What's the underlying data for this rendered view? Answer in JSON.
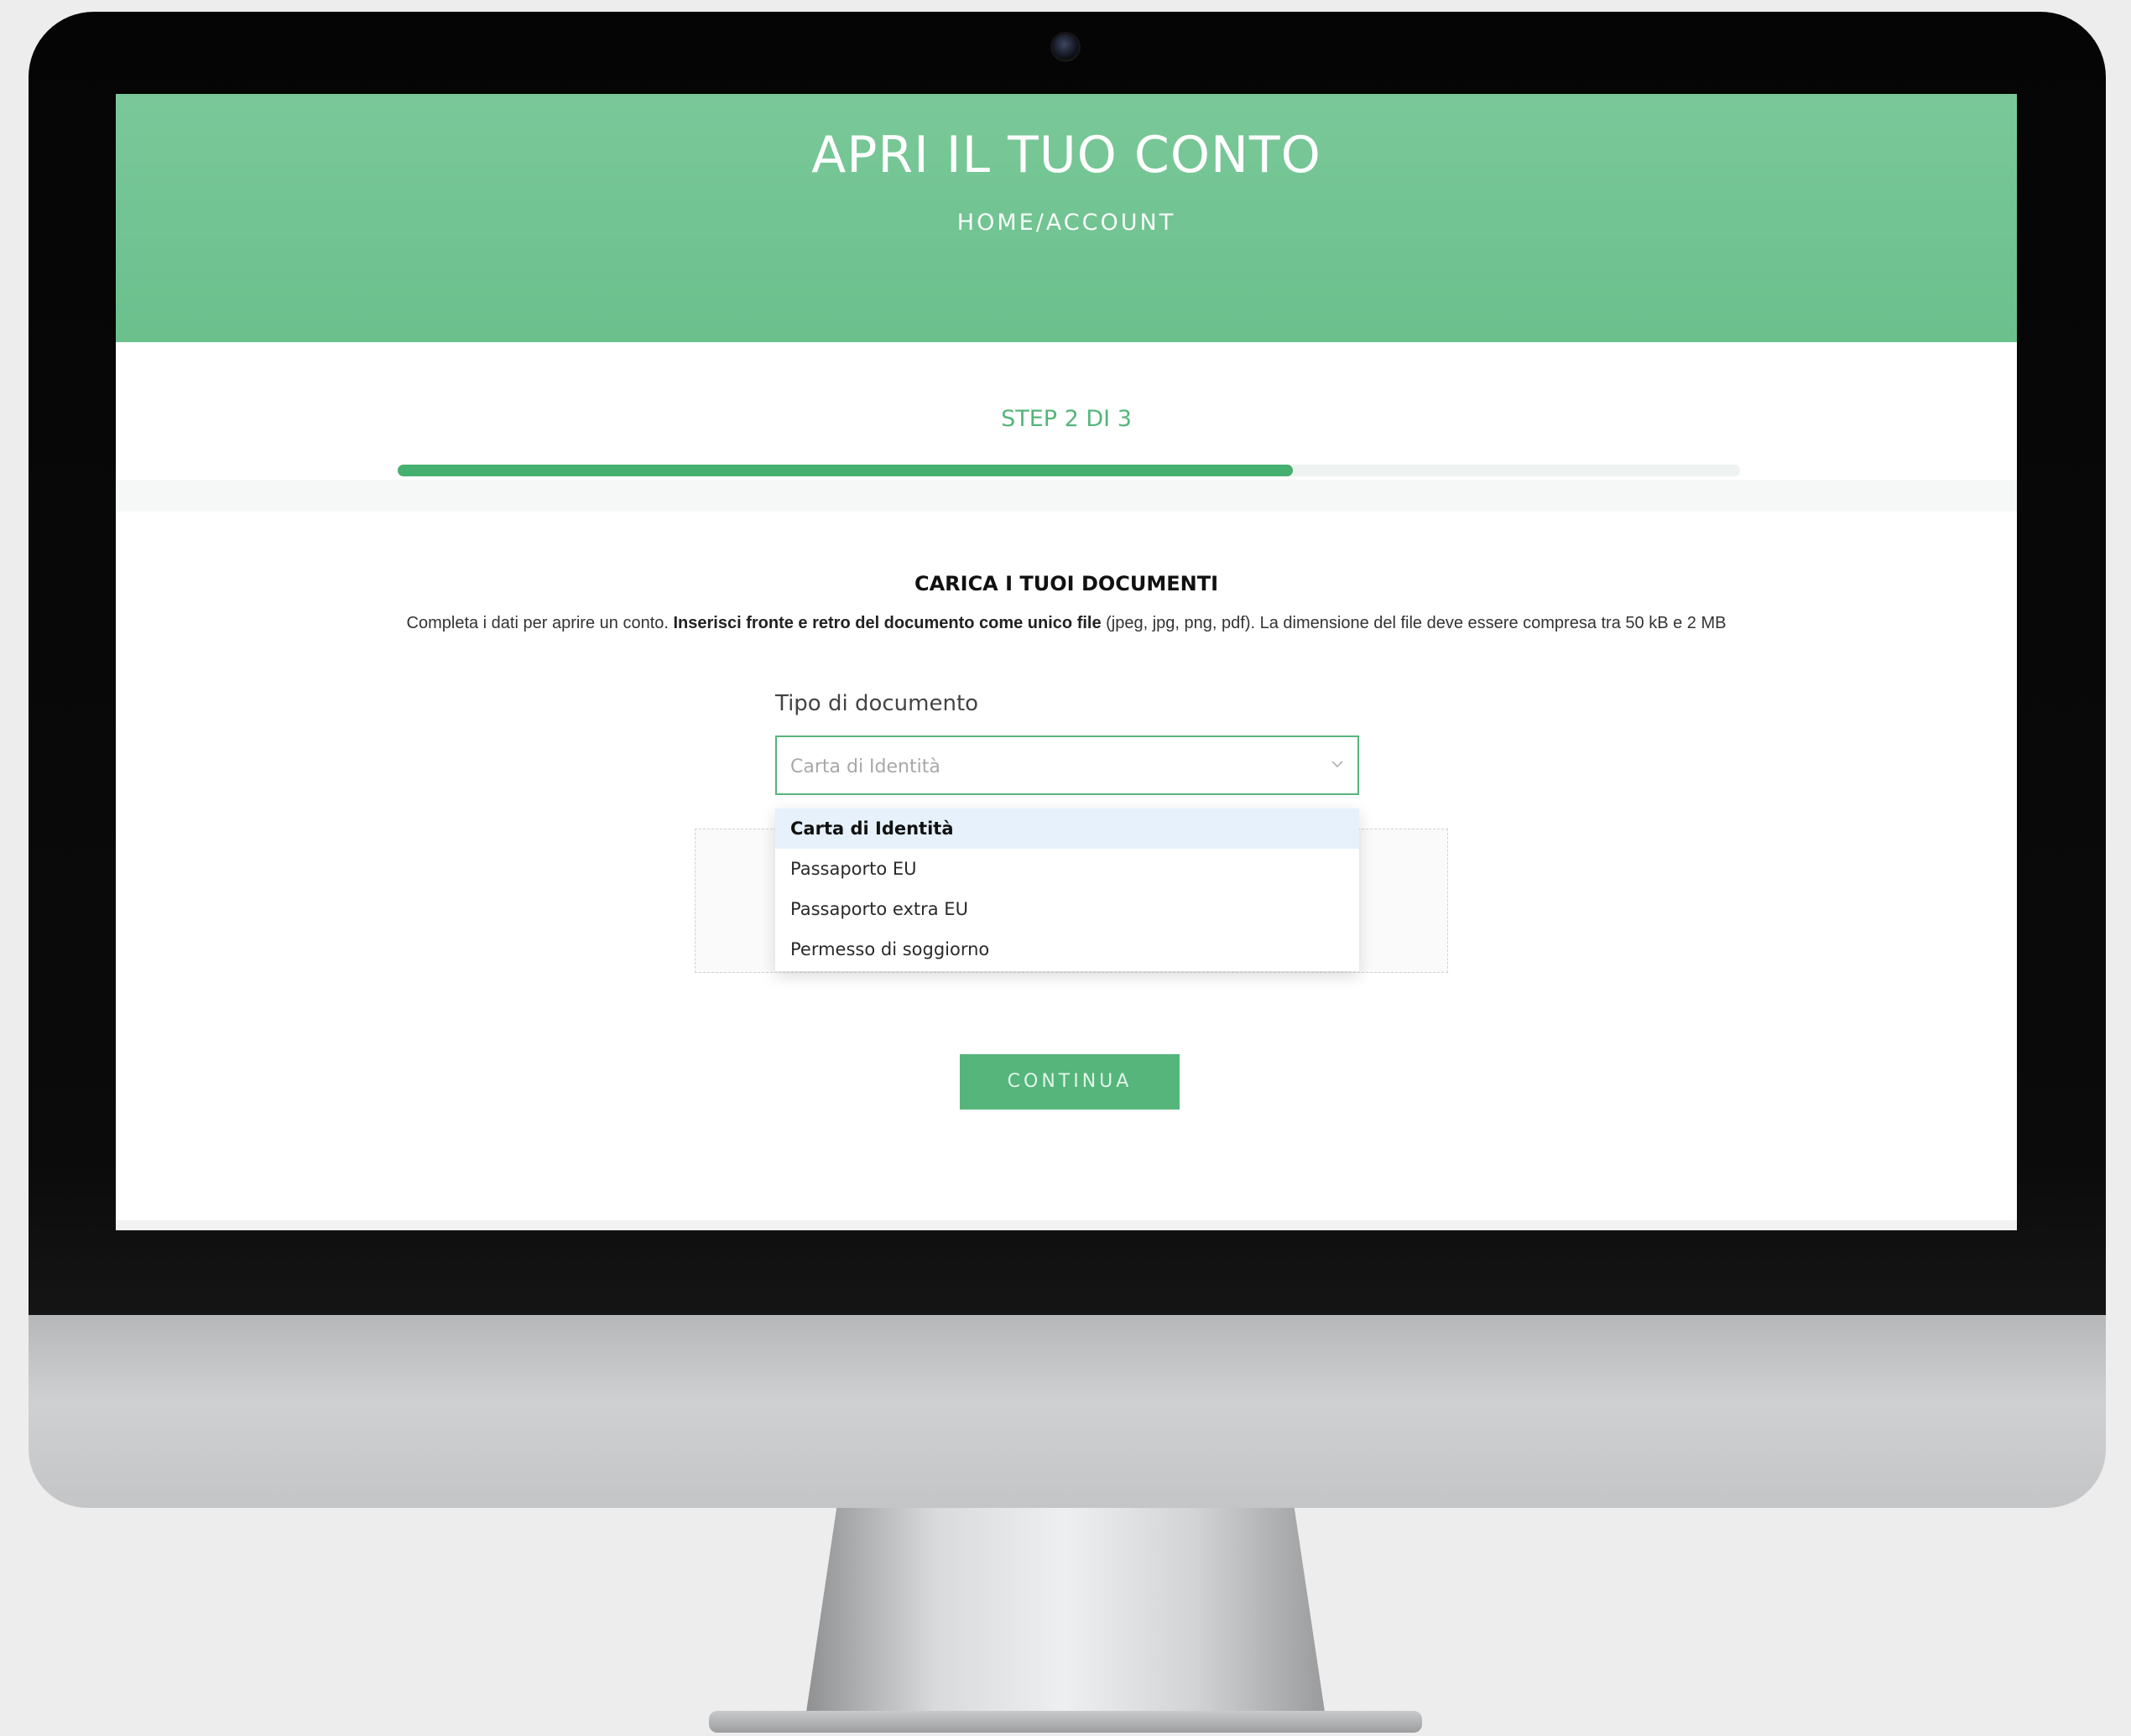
{
  "header": {
    "title": "APRI IL TUO CONTO",
    "breadcrumb": "HOME/ACCOUNT"
  },
  "progress": {
    "label": "STEP 2 DI 3",
    "fraction": 0.667
  },
  "upload": {
    "section_title": "CARICA I TUOI DOCUMENTI",
    "intro_prefix": "Completa i dati per aprire un conto. ",
    "intro_bold": "Inserisci fronte e retro del documento come unico file",
    "intro_suffix": " (jpeg, jpg, png, pdf). La dimensione del file deve essere compresa tra 50 kB e 2 MB"
  },
  "document_type": {
    "label": "Tipo di documento",
    "selected": "Carta di Identità",
    "options": [
      "Carta di Identità",
      "Passaporto EU",
      "Passaporto extra EU",
      "Permesso di soggiorno"
    ]
  },
  "actions": {
    "continue_label": "CONTINUA"
  },
  "colors": {
    "accent": "#55b57a",
    "header_bg": "#6bc08c",
    "selected_option_bg": "#e6f1fb"
  },
  "icons": {
    "select_chevron": "chevron-down-icon",
    "camera": "webcam"
  }
}
